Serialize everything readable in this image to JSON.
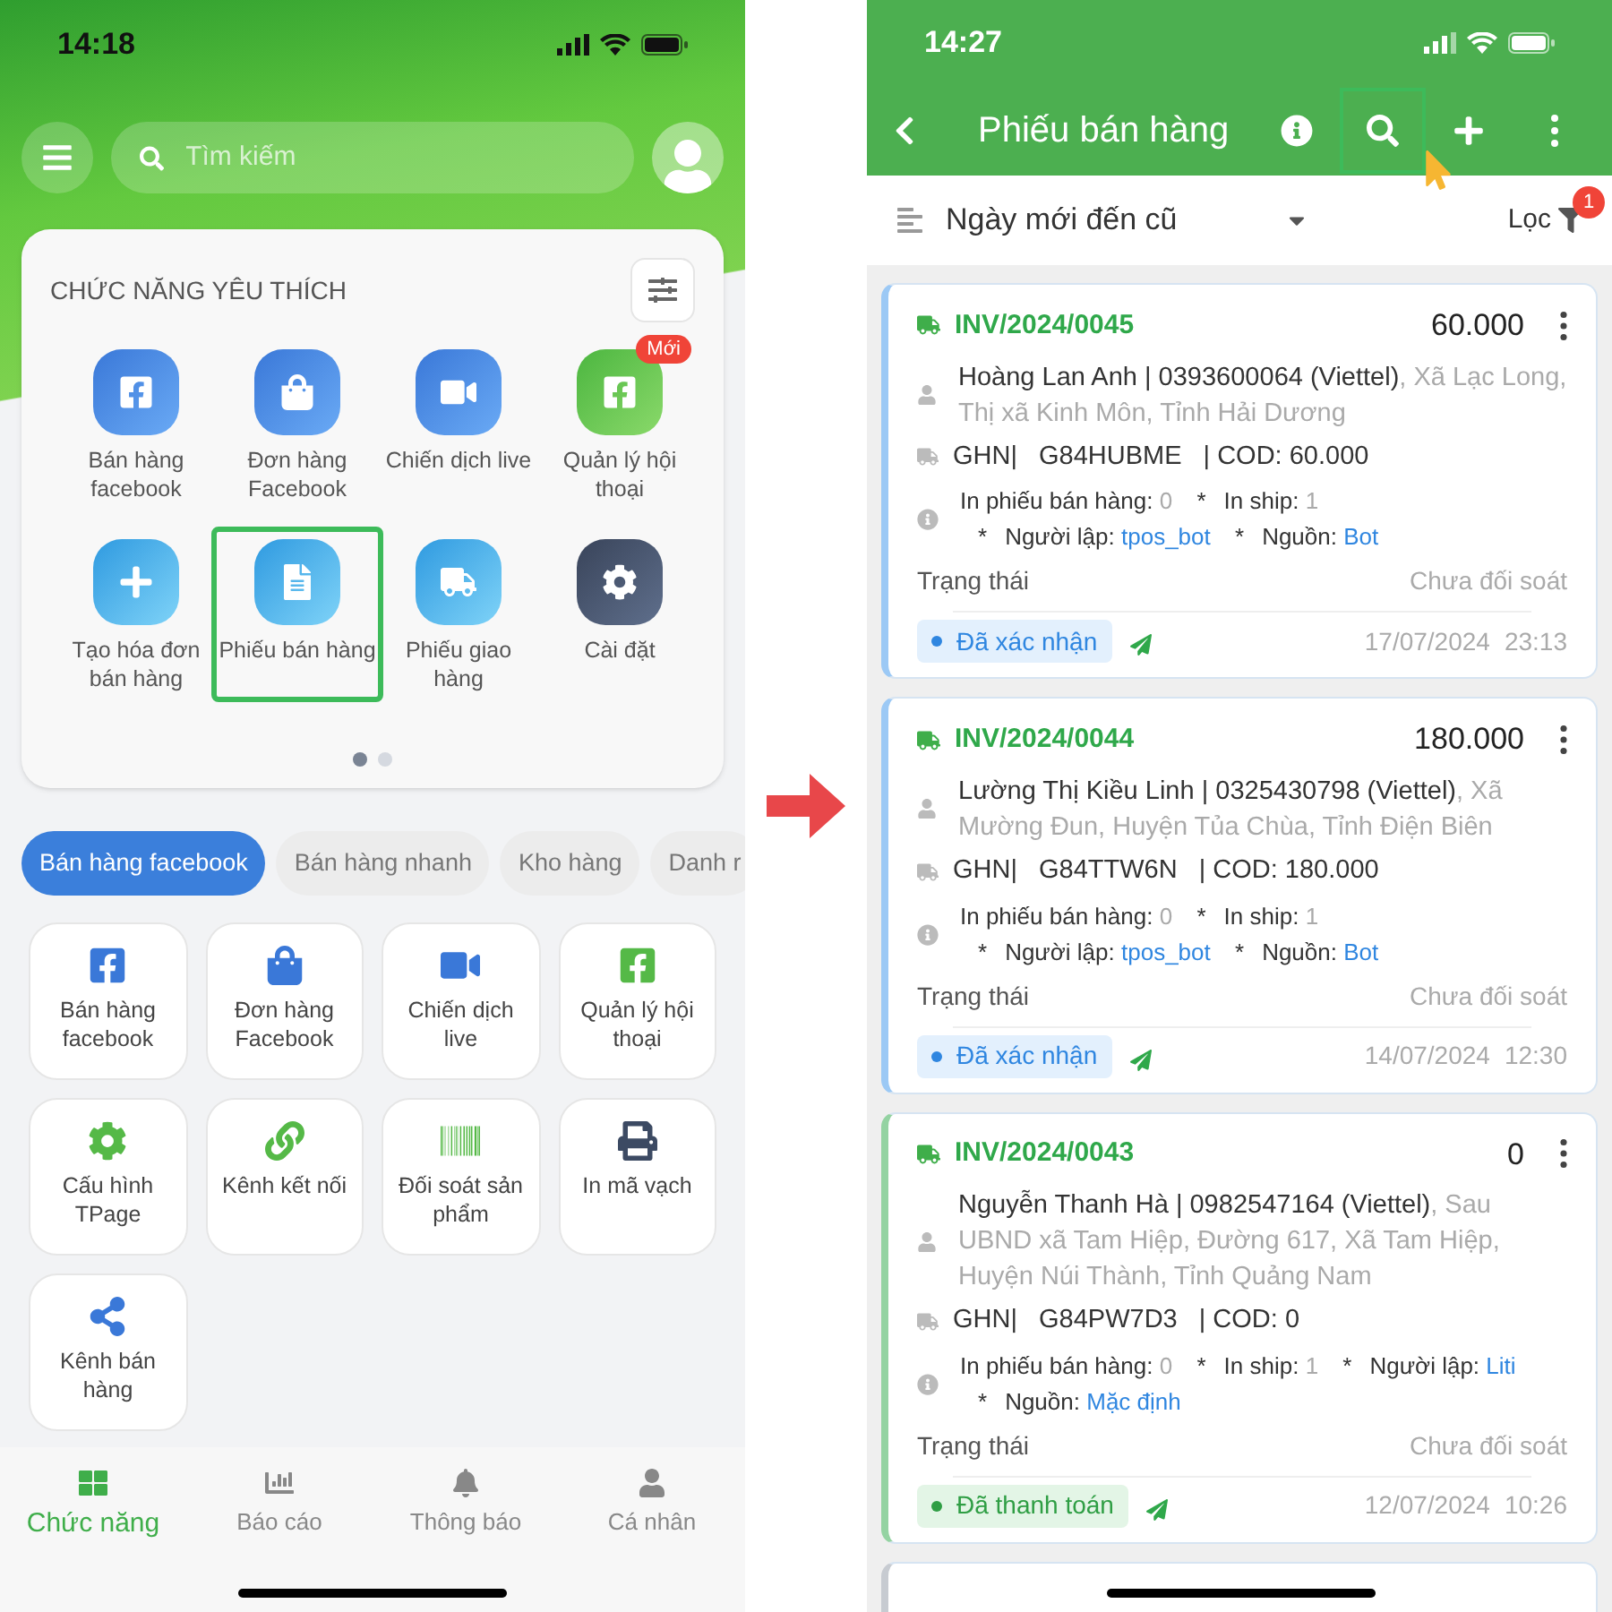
{
  "left_phone": {
    "status_time": "14:18",
    "search": {
      "placeholder": "Tìm kiếm"
    },
    "favorites": {
      "title": "CHỨC NĂNG YÊU THÍCH",
      "items": [
        {
          "label": "Bán hàng facebook",
          "kind": "facebook",
          "selected": false
        },
        {
          "label": "Đơn hàng Facebook",
          "kind": "bag",
          "selected": false
        },
        {
          "label": "Chiến dịch live",
          "kind": "video",
          "selected": false
        },
        {
          "label": "Quản lý hội thoại",
          "kind": "facebook-green",
          "badge": "Mới",
          "selected": false
        },
        {
          "label": "Tạo hóa đơn bán hàng",
          "kind": "plus",
          "selected": false
        },
        {
          "label": "Phiếu bán hàng",
          "kind": "document",
          "selected": true
        },
        {
          "label": "Phiếu giao hàng",
          "kind": "truck",
          "selected": false
        },
        {
          "label": "Cài đặt",
          "kind": "gear",
          "selected": false
        }
      ],
      "pages": [
        {
          "selected": true
        },
        {
          "selected": false
        }
      ]
    },
    "category_tabs": [
      {
        "label": "Bán hàng facebook",
        "selected": true
      },
      {
        "label": "Bán hàng nhanh",
        "selected": false
      },
      {
        "label": "Kho hàng",
        "selected": false
      },
      {
        "label": "Danh r",
        "selected": false
      }
    ],
    "functions": [
      {
        "label": "Bán hàng facebook",
        "kind": "facebook"
      },
      {
        "label": "Đơn hàng Facebook",
        "kind": "bag"
      },
      {
        "label": "Chiến dịch live",
        "kind": "video"
      },
      {
        "label": "Quản lý hội thoại",
        "kind": "facebook-green"
      },
      {
        "label": "Cấu hình TPage",
        "kind": "gear"
      },
      {
        "label": "Kênh kết nối",
        "kind": "link"
      },
      {
        "label": "Đối soát sản phẩm",
        "kind": "barcode"
      },
      {
        "label": "In mã vạch",
        "kind": "printer"
      },
      {
        "label": "Kênh bán hàng",
        "kind": "network"
      }
    ],
    "bottom_nav": [
      {
        "label": "Chức năng",
        "kind": "grid",
        "selected": true
      },
      {
        "label": "Báo cáo",
        "kind": "chart",
        "selected": false
      },
      {
        "label": "Thông báo",
        "kind": "bell",
        "selected": false
      },
      {
        "label": "Cá nhân",
        "kind": "person",
        "selected": false
      }
    ]
  },
  "right_phone": {
    "status_time": "14:27",
    "title": "Phiếu bán hàng",
    "header_actions": [
      {
        "kind": "info",
        "selected": false
      },
      {
        "kind": "search",
        "selected": true
      },
      {
        "kind": "add",
        "selected": false
      },
      {
        "kind": "more",
        "selected": false
      }
    ],
    "sort": {
      "label": "Ngày mới đến cũ"
    },
    "filter": {
      "label": "Lọc",
      "count": "1"
    },
    "invoices": [
      {
        "code": "INV/2024/0045",
        "amount": "60.000",
        "customer": "Hoàng Lan Anh | 0393600064 (Viettel)",
        "address": ", Xã Lạc Long, Thị xã Kinh Môn, Tỉnh Hải Dương",
        "carrier": "GHN|",
        "tracking": "G84HUBME",
        "cod": "| COD: 60.000",
        "info": [
          {
            "label": "In phiếu bán hàng:",
            "value": "0",
            "kind": "count"
          },
          {
            "sep": "*",
            "label": "In ship:",
            "value": "1",
            "kind": "count"
          },
          {
            "sep": "*",
            "label": "Người lập:",
            "value": "tpos_bot",
            "kind": "link"
          },
          {
            "sep": "*",
            "label": "Nguồn:",
            "value": "Bot",
            "kind": "link"
          }
        ],
        "status_caption": "Trạng thái",
        "reconcile": "Chưa đối soát",
        "status": {
          "label": "Đã xác nhận",
          "kind": "confirmed"
        },
        "date": "17/07/2024",
        "time": "23:13"
      },
      {
        "code": "INV/2024/0044",
        "amount": "180.000",
        "customer": "Lường Thị Kiều Linh | 0325430798 (Viettel)",
        "address": ", Xã Mường Đun, Huyện Tủa Chùa, Tỉnh Điện Biên",
        "carrier": "GHN|",
        "tracking": "G84TTW6N",
        "cod": "| COD: 180.000",
        "info": [
          {
            "label": "In phiếu bán hàng:",
            "value": "0",
            "kind": "count"
          },
          {
            "sep": "*",
            "label": "In ship:",
            "value": "1",
            "kind": "count"
          },
          {
            "sep": "*",
            "label": "Người lập:",
            "value": "tpos_bot",
            "kind": "link"
          },
          {
            "sep": "*",
            "label": "Nguồn:",
            "value": "Bot",
            "kind": "link"
          }
        ],
        "status_caption": "Trạng thái",
        "reconcile": "Chưa đối soát",
        "status": {
          "label": "Đã xác nhận",
          "kind": "confirmed"
        },
        "date": "14/07/2024",
        "time": "12:30"
      },
      {
        "code": "INV/2024/0043",
        "amount": "0",
        "customer": "Nguyễn Thanh Hà | 0982547164 (Viettel)",
        "address": ", Sau UBND xã Tam Hiệp, Đường 617, Xã Tam Hiệp, Huyện Núi Thành, Tỉnh Quảng Nam",
        "carrier": "GHN|",
        "tracking": "G84PW7D3",
        "cod": "| COD: 0",
        "info": [
          {
            "label": "In phiếu bán hàng:",
            "value": "0",
            "kind": "count"
          },
          {
            "sep": "*",
            "label": "In ship:",
            "value": "1",
            "kind": "count"
          },
          {
            "sep": "*",
            "label": "Người lập:",
            "value": "Liti",
            "kind": "link"
          },
          {
            "sep": "*",
            "label": "Nguồn:",
            "value": "Mặc định",
            "kind": "link"
          }
        ],
        "status_caption": "Trạng thái",
        "reconcile": "Chưa đối soát",
        "status": {
          "label": "Đã thanh toán",
          "kind": "paid"
        },
        "date": "12/07/2024",
        "time": "10:26"
      }
    ]
  }
}
